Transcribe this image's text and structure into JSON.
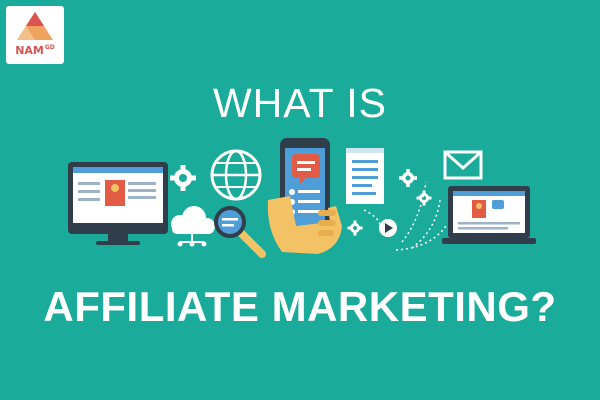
{
  "brand": {
    "logo_text": "NAM",
    "logo_suffix": "GD",
    "colors": {
      "red": "#d9534f",
      "orange": "#f0a35e",
      "peach": "#f4c08a"
    }
  },
  "headline": {
    "top": "WHAT IS",
    "bottom": "AFFILIATE MARKETING?"
  },
  "theme": {
    "background": "#1aab9b",
    "text": "#ffffff",
    "dark": "#2f3e4a",
    "accent_blue": "#4f9ed8",
    "accent_red": "#e25b45",
    "accent_yellow": "#f2c265"
  },
  "icons": [
    "desktop-monitor-icon",
    "gear-icon",
    "globe-icon",
    "cloud-network-icon",
    "magnifier-icon",
    "smartphone-hand-icon",
    "chat-bubble-icon",
    "document-icon",
    "envelope-icon",
    "play-button-icon",
    "laptop-icon"
  ]
}
